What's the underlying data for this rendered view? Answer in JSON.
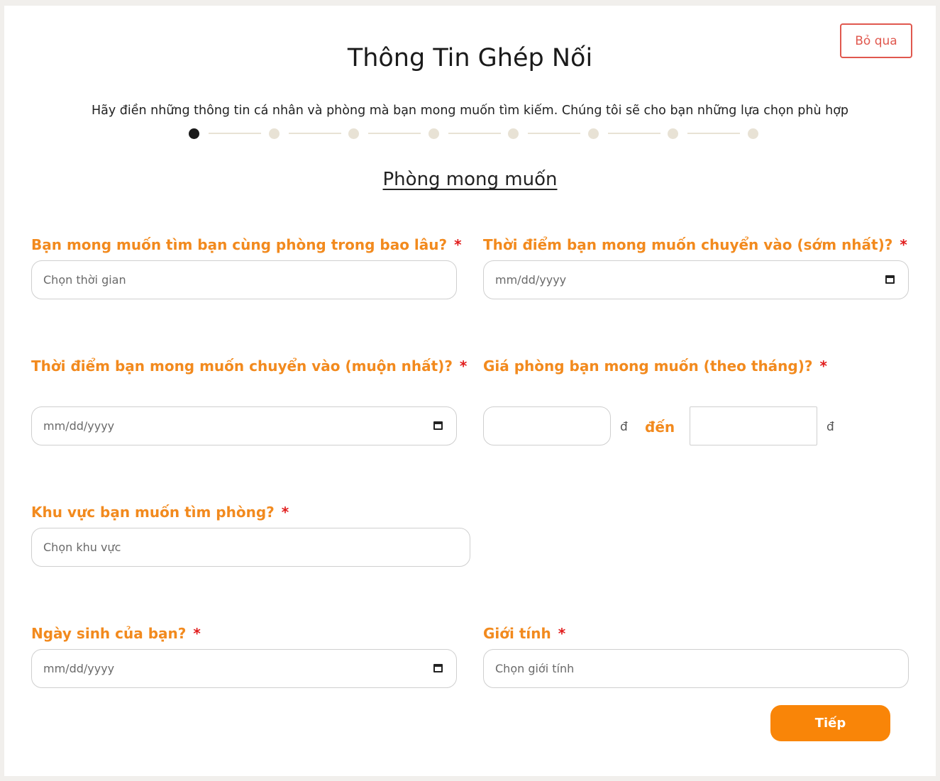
{
  "header": {
    "skip_label": "Bỏ qua",
    "title": "Thông Tin Ghép Nối",
    "subtitle": "Hãy điền những thông tin cá nhân và phòng mà bạn mong muốn tìm kiếm. Chúng tôi sẽ cho bạn những lựa chọn phù hợp"
  },
  "stepper": {
    "total_steps": 8,
    "current_step": 1
  },
  "section_title": "Phòng mong muốn",
  "form": {
    "required_mark": "*",
    "duration": {
      "label": "Bạn mong muốn tìm bạn cùng phòng trong bao lâu?",
      "placeholder": "Chọn thời gian"
    },
    "move_in_earliest": {
      "label": "Thời điểm bạn mong muốn chuyển vào (sớm nhất)?",
      "placeholder": "mm/dd/yyyy"
    },
    "move_in_latest": {
      "label": "Thời điểm bạn mong muốn chuyển vào (muộn nhất)?",
      "placeholder": "mm/dd/yyyy"
    },
    "price": {
      "label": "Giá phòng bạn mong muốn (theo tháng)?",
      "min_value": "",
      "max_value": "",
      "currency": "đ",
      "separator": "đến"
    },
    "area": {
      "label": "Khu vực bạn muốn tìm phòng?",
      "placeholder": "Chọn khu vực"
    },
    "birthday": {
      "label": "Ngày sinh của bạn?",
      "placeholder": "mm/dd/yyyy"
    },
    "gender": {
      "label": "Giới tính",
      "placeholder": "Chọn giới tính"
    }
  },
  "next_label": "Tiếp",
  "colors": {
    "accent": "#f28a1e",
    "button": "#f98508",
    "required": "#e11c1c",
    "skip": "#e0584e",
    "step_inactive": "#e8e2d5",
    "step_active": "#1a1a1a"
  }
}
